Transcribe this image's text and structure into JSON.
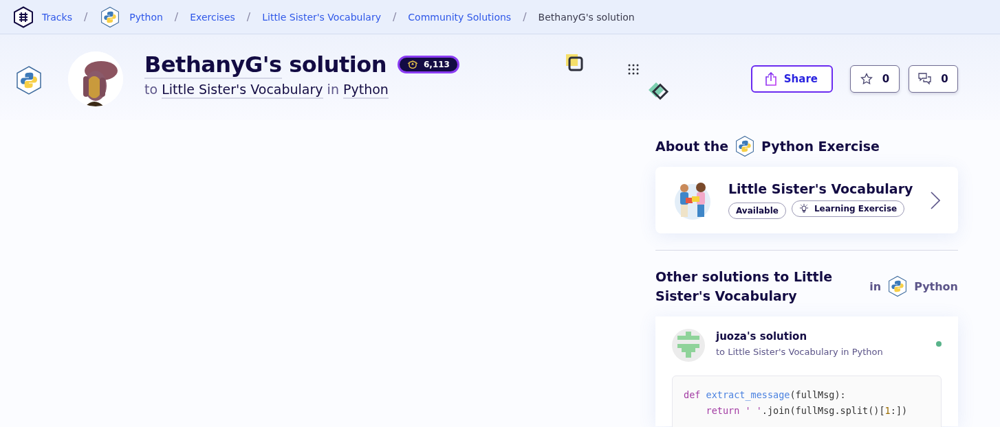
{
  "breadcrumbs": [
    {
      "label": "Tracks",
      "kind": "tracks",
      "current": false
    },
    {
      "label": "Python",
      "kind": "python",
      "separator": "/",
      "current": false
    },
    {
      "label": "Exercises",
      "separator": "/",
      "current": false
    },
    {
      "label": "Little Sister's Vocabulary",
      "separator": "/",
      "current": false
    },
    {
      "label": "Community Solutions",
      "separator": "/",
      "current": false
    },
    {
      "label": "BethanyG's solution",
      "separator": "/",
      "current": true
    }
  ],
  "solution": {
    "author": "BethanyG's",
    "title_rest": "solution",
    "reputation": "6,113",
    "to": "to",
    "exercise": "Little Sister's Vocabulary",
    "in": "in",
    "track": "Python"
  },
  "actions": {
    "share": "Share",
    "stars": "0",
    "comments": "0"
  },
  "about": {
    "heading_start": "About the",
    "heading_end": "Python Exercise",
    "exercise": {
      "title": "Little Sister's Vocabulary",
      "tags": [
        {
          "label": "Available",
          "kind": "plain"
        },
        {
          "label": "Learning Exercise",
          "kind": "learning"
        }
      ]
    }
  },
  "other": {
    "heading": "Other solutions to Little Sister's Vocabulary",
    "in": "in",
    "track": "Python",
    "solutions": [
      {
        "title": "juoza's solution",
        "subtitle": "to Little Sister's Vocabulary in Python",
        "code": [
          {
            "indented": false,
            "tokens": [
              {
                "kind": "keyword",
                "text": "def"
              },
              {
                "kind": "function",
                "text": " extract_message"
              },
              {
                "kind": "plain",
                "text": "(fullMsg):"
              }
            ]
          },
          {
            "indented": true,
            "tokens": [
              {
                "kind": "keyword",
                "text": "return"
              },
              {
                "kind": "string",
                "text": " ' '"
              },
              {
                "kind": "plain",
                "text": ".join(fullMsg.split()["
              },
              {
                "kind": "number",
                "text": "1"
              },
              {
                "kind": "plain",
                "text": ":])"
              }
            ]
          }
        ]
      }
    ]
  }
}
